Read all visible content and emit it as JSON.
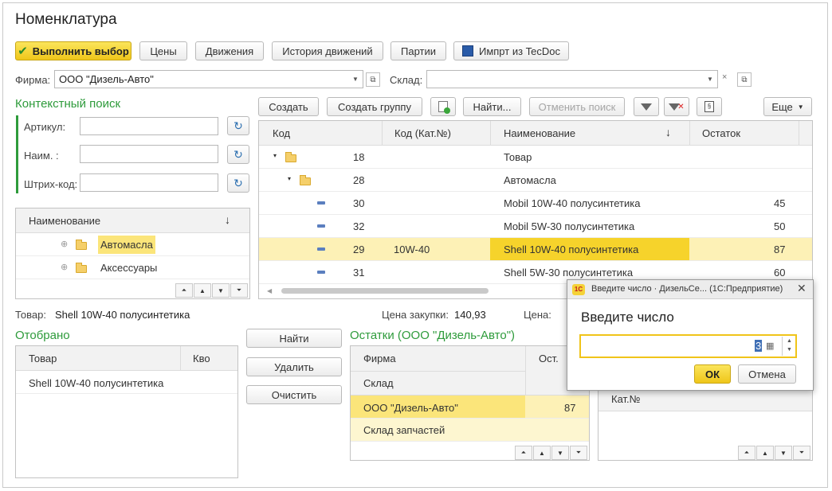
{
  "window": {
    "title": "Номенклатура"
  },
  "toolbar": {
    "execute_label": "Выполнить выбор",
    "prices_label": "Цены",
    "movements_label": "Движения",
    "history_label": "История движений",
    "batches_label": "Партии",
    "import_label": "Импрт из TecDoc"
  },
  "filters": {
    "firm_label": "Фирма:",
    "firm_value": "ООО \"Дизель-Авто\"",
    "warehouse_label": "Склад:",
    "warehouse_value": ""
  },
  "context_search": {
    "title": "Контекстный поиск",
    "article_label": "Артикул:",
    "name_label": "Наим.     :",
    "barcode_label": "Штрих-код:"
  },
  "groups_tree": {
    "header": "Наименование",
    "sort_glyph": "↓",
    "items": [
      {
        "label": "Автомасла",
        "selected": true
      },
      {
        "label": "Аксессуары",
        "selected": false
      }
    ]
  },
  "list_toolbar": {
    "create_label": "Создать",
    "create_group_label": "Создать группу",
    "find_label": "Найти...",
    "cancel_search_label": "Отменить поиск",
    "more_label": "Еще"
  },
  "items_table": {
    "columns": [
      "Код",
      "Код (Кат.№)",
      "Наименование",
      "Остаток"
    ],
    "sort_glyph": "↓",
    "rows": [
      {
        "type": "folder",
        "code": "18",
        "cat": "",
        "name": "Товар",
        "rest": ""
      },
      {
        "type": "folder",
        "code": "28",
        "cat": "",
        "name": "Автомасла",
        "rest": ""
      },
      {
        "type": "item",
        "code": "30",
        "cat": "",
        "name": "Mobil 10W-40 полусинтетика",
        "rest": "45"
      },
      {
        "type": "item",
        "code": "32",
        "cat": "",
        "name": "Mobil 5W-30 полусинтетика",
        "rest": "50"
      },
      {
        "type": "item",
        "code": "29",
        "cat": "10W-40",
        "name": "Shell 10W-40 полусинтетика",
        "rest": "87"
      },
      {
        "type": "item",
        "code": "31",
        "cat": "",
        "name": "Shell 5W-30 полусинтетика",
        "rest": "60"
      }
    ]
  },
  "info": {
    "product_label": "Товар:",
    "product_value": "Shell 10W-40 полусинтетика",
    "purchase_price_label": "Цена закупки:",
    "purchase_price_value": "140,93",
    "price_label": "Цена:"
  },
  "selected_panel": {
    "title": "Отобрано",
    "columns": [
      "Товар",
      "Кво"
    ],
    "rows": [
      {
        "product": "Shell 10W-40 полусинтетика",
        "qty": ""
      }
    ]
  },
  "actions": {
    "find_label": "Найти",
    "delete_label": "Удалить",
    "clear_label": "Очистить"
  },
  "stock_panel": {
    "title": "Остатки (ООО \"Дизель-Авто\")",
    "col_firm": "Фирма",
    "col_warehouse": "Склад",
    "col_rest": "Ост.",
    "firm_value": "ООО \"Дизель-Авто\"",
    "rest_value": "87",
    "warehouse_value": "Склад запчастей"
  },
  "right_panel": {
    "col_cat": "Кат.№"
  },
  "dialog": {
    "title": "Введите число · ДизельСе...  (1С:Предприятие)",
    "heading": "Введите число",
    "value": "3",
    "ok_label": "ОК",
    "cancel_label": "Отмена",
    "logo": "1С"
  }
}
